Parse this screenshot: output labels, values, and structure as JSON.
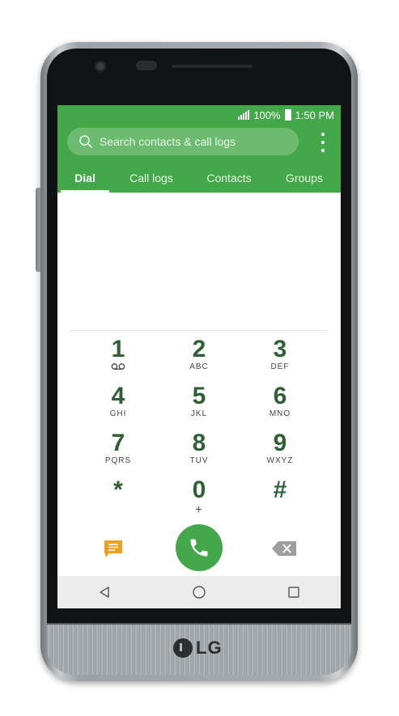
{
  "status": {
    "battery": "100%",
    "time": "1:50 PM"
  },
  "search": {
    "placeholder": "Search contacts & call logs"
  },
  "tabs": [
    {
      "label": "Dial",
      "active": true
    },
    {
      "label": "Call logs"
    },
    {
      "label": "Contacts"
    },
    {
      "label": "Groups"
    }
  ],
  "keypad": [
    {
      "num": "1",
      "letters": ""
    },
    {
      "num": "2",
      "letters": "ABC"
    },
    {
      "num": "3",
      "letters": "DEF"
    },
    {
      "num": "4",
      "letters": "GHI"
    },
    {
      "num": "5",
      "letters": "JKL"
    },
    {
      "num": "6",
      "letters": "MNO"
    },
    {
      "num": "7",
      "letters": "PQRS"
    },
    {
      "num": "8",
      "letters": "TUV"
    },
    {
      "num": "9",
      "letters": "WXYZ"
    },
    {
      "num": "*",
      "letters": ""
    },
    {
      "num": "0",
      "letters": "+"
    },
    {
      "num": "#",
      "letters": ""
    }
  ],
  "brand": {
    "logo_text": "LG"
  },
  "colors": {
    "accent": "#43a84a",
    "key_text": "#2e5f35",
    "message_icon": "#f0a020"
  },
  "icons": {
    "search": "search-icon",
    "menu": "more-vert-icon",
    "voicemail": "voicemail-icon",
    "message": "message-icon",
    "call": "phone-icon",
    "delete": "backspace-icon",
    "back": "back-icon",
    "home": "home-icon",
    "recents": "recents-icon"
  }
}
